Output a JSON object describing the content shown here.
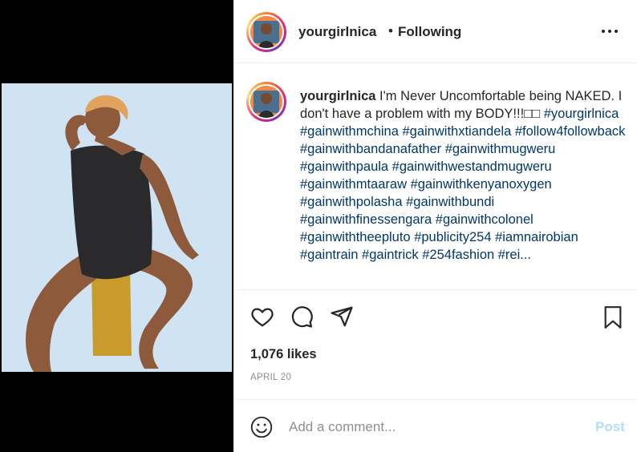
{
  "post": {
    "username": "yourgirlnica",
    "separator": "•",
    "follow_status": "Following",
    "more_icon": "more-horizontal-icon"
  },
  "caption": {
    "username": "yourgirlnica",
    "text": "I'm Never Uncomfortable being NAKED. I don't have a problem with my BODY!!!□□",
    "hashtags": "#yourgirlnica #gainwithmchina #gainwithxtiandela #follow4followback #gainwithbandanafather #gainwithmugweru #gainwithpaula #gainwithwestandmugweru #gainwithmtaaraw #gainwithkenyanoxygen #gainwithpolasha #gainwithbundi #gainwithfinessengara #gainwithcolonel #gainwiththeepluto #publicity254 #iamnairobian #gaintrain #gaintrick #254fashion #rei...",
    "hashtag_color": "#00376b"
  },
  "actions": {
    "like_icon": "heart-icon",
    "comment_icon": "comment-icon",
    "share_icon": "share-icon",
    "save_icon": "bookmark-icon"
  },
  "likes": "1,076 likes",
  "date": "APRIL 20",
  "comment": {
    "emoji_icon": "smiley-icon",
    "placeholder": "Add a comment...",
    "post_label": "Post",
    "post_color": "#b3dbff"
  }
}
